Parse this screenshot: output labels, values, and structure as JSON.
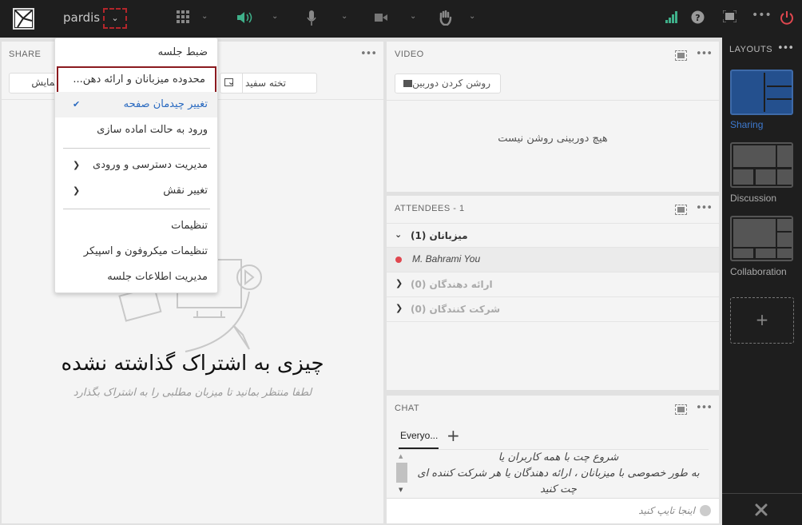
{
  "topbar": {
    "app_name": "pardis",
    "icons": [
      "apps-grid-icon",
      "speaker-icon",
      "microphone-icon",
      "camera-icon",
      "raise-hand-icon"
    ],
    "right_icons": [
      "signal-icon",
      "help-icon",
      "fullscreen-icon",
      "more-icon",
      "power-icon"
    ],
    "colors": {
      "speaker": "#3fb08a",
      "signal": "#3fb08a",
      "power": "#e0474f"
    }
  },
  "menu": {
    "items": [
      {
        "label": "ضبط جلسه"
      },
      {
        "label": "محدوده میزبانان و ارائه دهن..."
      },
      {
        "label": "تغییر چیدمان صفحه",
        "checked": true
      },
      {
        "label": "ورود به حالت اماده سازی"
      },
      {
        "label": "مدیریت دسترسی و ورودی",
        "submenu": true
      },
      {
        "label": "تغییر نقش",
        "submenu": true
      },
      {
        "label": "تنظیمات"
      },
      {
        "label": "تنظیمات میکروفون و اسپیکر"
      },
      {
        "label": "مدیریت اطلاعات جلسه"
      }
    ]
  },
  "share": {
    "title": "SHARE",
    "screen_button": "نمایش",
    "whiteboard_button": "تخته سفید",
    "empty_title": "چیزی به اشتراک گذاشته نشده",
    "empty_subtitle": "لطفا منتظر بمانید تا میزبان مطلبی را به اشتراک بگذارد"
  },
  "video": {
    "title": "VIDEO",
    "camera_button": "روشن کردن دوربین",
    "empty": "هیچ دوربینی روشن نیست"
  },
  "attendees": {
    "title": "ATTENDEES  - 1",
    "groups": [
      {
        "label": "میزبانان (1)",
        "expanded": true
      },
      {
        "label": "ارائه دهندگان (0)"
      },
      {
        "label": "شرکت کنندگان (0)"
      }
    ],
    "member": "M. Bahrami You"
  },
  "chat": {
    "title": "CHAT",
    "tab": "Everyo...",
    "message_lines": [
      "شروع چت با همه کاربران یا",
      "به طور خصوصی با میزبانان ، ارائه دهندگان یا هر شرکت کننده ای",
      "چت کنید"
    ],
    "input_placeholder": "اینجا تایپ کنید"
  },
  "layouts": {
    "title": "LAYOUTS",
    "items": [
      {
        "label": "Sharing",
        "active": true
      },
      {
        "label": "Discussion"
      },
      {
        "label": "Collaboration"
      }
    ],
    "add": "+"
  }
}
